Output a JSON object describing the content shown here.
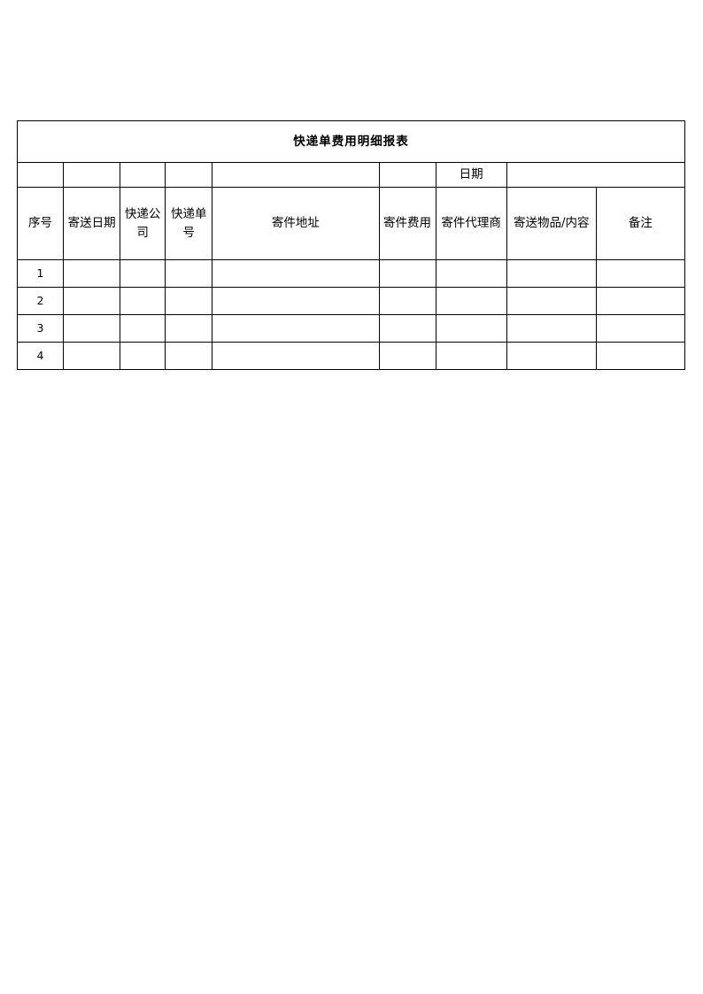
{
  "document": {
    "title": "快递单费用明细报表",
    "page_background": "#ffffff",
    "text_color": "#000000",
    "border_color": "#000000"
  },
  "table": {
    "title_row": {
      "text": "快递单费用明细报表"
    },
    "date_row": {
      "cells": [
        "",
        "",
        "",
        "",
        "",
        "",
        "日期",
        ""
      ],
      "date_label": "日期"
    },
    "headers": [
      "序号",
      "寄送日期",
      "快递公司",
      "快递单号",
      "寄件地址",
      "寄件费用",
      "寄件代理商",
      "寄送物品/内容",
      "备注"
    ],
    "rows": [
      {
        "seq": "1",
        "date": "",
        "company": "",
        "waybill": "",
        "address": "",
        "fee": "",
        "agent": "",
        "goods": "",
        "remark": ""
      },
      {
        "seq": "2",
        "date": "",
        "company": "",
        "waybill": "",
        "address": "",
        "fee": "",
        "agent": "",
        "goods": "",
        "remark": ""
      },
      {
        "seq": "3",
        "date": "",
        "company": "",
        "waybill": "",
        "address": "",
        "fee": "",
        "agent": "",
        "goods": "",
        "remark": ""
      },
      {
        "seq": "4",
        "date": "",
        "company": "",
        "waybill": "",
        "address": "",
        "fee": "",
        "agent": "",
        "goods": "",
        "remark": ""
      }
    ]
  }
}
